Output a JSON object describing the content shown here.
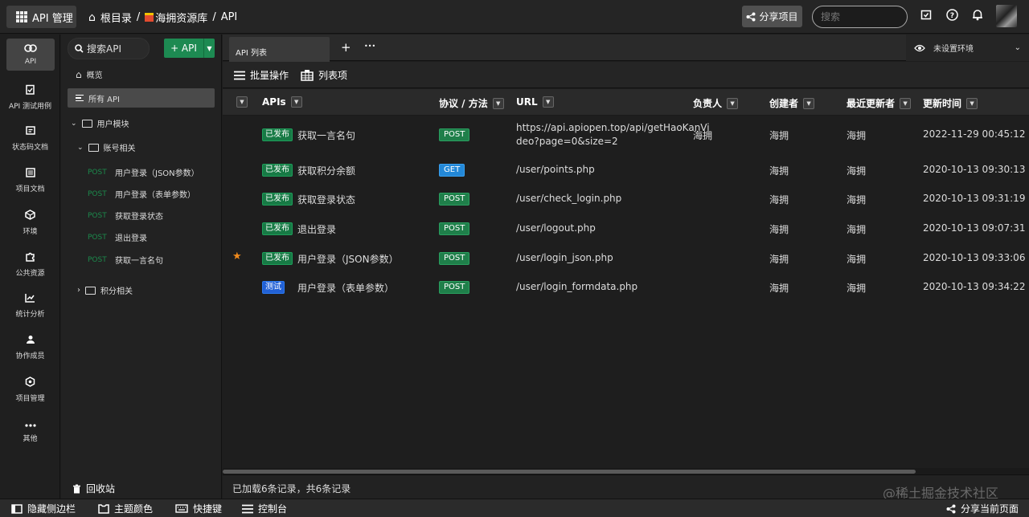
{
  "topbar": {
    "app_label": "API 管理",
    "crumbs": [
      "根目录",
      "海拥资源库",
      "API"
    ],
    "share_label": "分享项目",
    "search_placeholder": "搜索"
  },
  "rail": [
    {
      "label": "API",
      "icon": "link-icon"
    },
    {
      "label": "API 测试用例",
      "icon": "test-case-icon"
    },
    {
      "label": "状态码文档",
      "icon": "status-code-icon"
    },
    {
      "label": "项目文档",
      "icon": "document-icon"
    },
    {
      "label": "环境",
      "icon": "environment-icon"
    },
    {
      "label": "公共资源",
      "icon": "puzzle-icon"
    },
    {
      "label": "统计分析",
      "icon": "chart-icon"
    },
    {
      "label": "协作成员",
      "icon": "members-icon"
    },
    {
      "label": "项目管理",
      "icon": "settings-icon"
    },
    {
      "label": "其他",
      "icon": "more-icon"
    }
  ],
  "tree": {
    "search_placeholder": "搜索API",
    "add_label": "+ API",
    "overview": "概览",
    "all_api": "所有 API",
    "folder_user": "用户模块",
    "folder_account": "账号相关",
    "method_post": "POST",
    "items": [
      "用户登录（JSON参数）",
      "用户登录（表单参数）",
      "获取登录状态",
      "退出登录",
      "获取一言名句"
    ],
    "folder_points": "积分相关",
    "recycle": "回收站"
  },
  "tabs": {
    "active": "API 列表",
    "add": "+",
    "more": "•••",
    "env": "未设置环境"
  },
  "toolbar": {
    "batch": "批量操作",
    "columns": "列表项"
  },
  "table": {
    "headers": [
      "APIs",
      "协议 / 方法",
      "URL",
      "负责人",
      "创建者",
      "最近更新者",
      "更新时间"
    ],
    "rows": [
      {
        "status": "已发布",
        "name": "获取一言名句",
        "method": "POST",
        "url1": "https://api.apiopen.top/api/getHaoKanVi",
        "url2": "deo?page=0&size=2",
        "owner": "海拥",
        "creator": "海拥",
        "updater": "海拥",
        "time": "2022-11-29 00:45:12"
      },
      {
        "status": "已发布",
        "name": "获取积分余额",
        "method": "GET",
        "url1": "/user/points.php",
        "url2": "",
        "owner": "",
        "creator": "海拥",
        "updater": "海拥",
        "time": "2020-10-13 09:30:13"
      },
      {
        "status": "已发布",
        "name": "获取登录状态",
        "method": "POST",
        "url1": "/user/check_login.php",
        "url2": "",
        "owner": "",
        "creator": "海拥",
        "updater": "海拥",
        "time": "2020-10-13 09:31:19"
      },
      {
        "status": "已发布",
        "name": "退出登录",
        "method": "POST",
        "url1": "/user/logout.php",
        "url2": "",
        "owner": "",
        "creator": "海拥",
        "updater": "海拥",
        "time": "2020-10-13 09:07:31"
      },
      {
        "status": "已发布",
        "name": "用户登录（JSON参数）",
        "method": "POST",
        "url1": "/user/login_json.php",
        "url2": "",
        "owner": "",
        "creator": "海拥",
        "updater": "海拥",
        "time": "2020-10-13 09:33:06"
      },
      {
        "status": "测试",
        "name": "用户登录（表单参数）",
        "method": "POST",
        "url1": "/user/login_formdata.php",
        "url2": "",
        "owner": "",
        "creator": "海拥",
        "updater": "海拥",
        "time": "2020-10-13 09:34:22"
      }
    ],
    "status_line": "已加载6条记录，共6条记录"
  },
  "bottombar": {
    "hide_sidebar": "隐藏侧边栏",
    "theme": "主题颜色",
    "shortcuts": "快捷键",
    "console": "控制台",
    "share_page": "分享当前页面"
  },
  "watermark": "@稀土掘金技术社区"
}
